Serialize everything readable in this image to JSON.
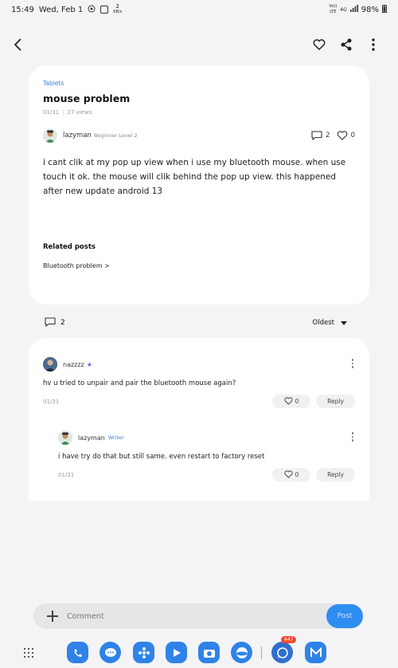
{
  "status_bar": {
    "time": "15:49",
    "date": "Wed, Feb 1",
    "net_speed": "2",
    "net_unit": "KB/s",
    "volte": "Vo))",
    "lte": "LTE",
    "network": "4G",
    "battery": "98%"
  },
  "post": {
    "category": "Tablets",
    "title": "mouse problem",
    "date": "01/31",
    "views": "27 views",
    "author": "lazyman",
    "author_level": "Beginner Level 2",
    "comment_count": "2",
    "like_count": "0",
    "body": "i cant clik at my pop up view when i use my bluetooth mouse. when use touch it ok. the mouse will clik behind the pop up view. this happened after new update android 13",
    "related_title": "Related posts",
    "related_link": "Bluetooth problem >"
  },
  "comments_bar": {
    "count": "2",
    "sort": "Oldest"
  },
  "comments": [
    {
      "author": "nazzzz",
      "star": "★",
      "text": "hv u tried to unpair and pair the bluetooth mouse again?",
      "date": "01/31",
      "likes": "0",
      "reply_label": "Reply"
    },
    {
      "author": "lazyman",
      "badge": "Writer",
      "text": "i have try do that but still same. even restart to factory reset",
      "date": "01/31",
      "likes": "0",
      "reply_label": "Reply"
    }
  ],
  "input": {
    "placeholder": "Comment",
    "post_label": "Post"
  },
  "dock": {
    "whatsapp_badge": "447"
  },
  "colors": {
    "accent": "#2e8df0",
    "link": "#3d7fd6",
    "background": "#f4f4f6"
  }
}
